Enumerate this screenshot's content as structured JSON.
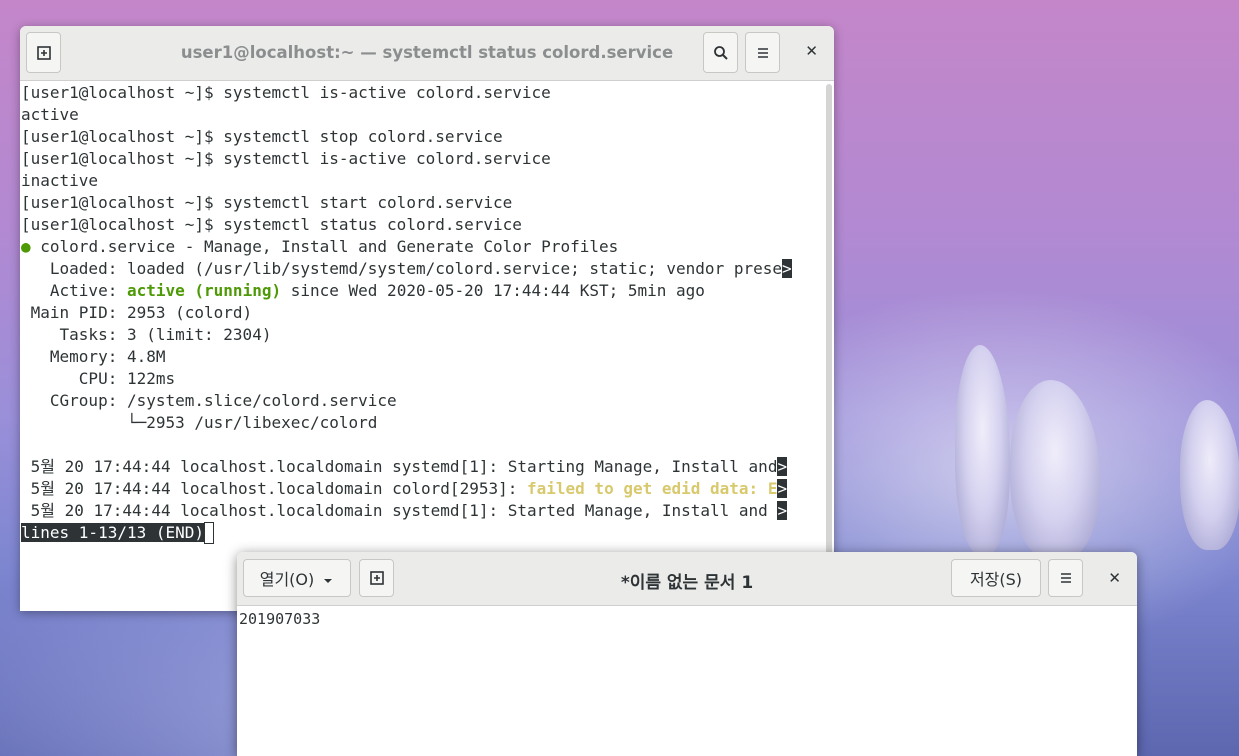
{
  "terminal": {
    "title": "user1@localhost:~ — systemctl status colord.service",
    "lines": [
      "[user1@localhost ~]$ systemctl is-active colord.service",
      "active",
      "[user1@localhost ~]$ systemctl stop colord.service",
      "[user1@localhost ~]$ systemctl is-active colord.service",
      "inactive",
      "[user1@localhost ~]$ systemctl start colord.service",
      "[user1@localhost ~]$ systemctl status colord.service"
    ],
    "status": {
      "bullet": "●",
      "service_line": " colord.service - Manage, Install and Generate Color Profiles",
      "loaded": "   Loaded: loaded (/usr/lib/systemd/system/colord.service; static; vendor prese",
      "active_label": "   Active: ",
      "active_value": "active (running)",
      "active_rest": " since Wed 2020-05-20 17:44:44 KST; 5min ago",
      "main_pid": " Main PID: 2953 (colord)",
      "tasks": "    Tasks: 3 (limit: 2304)",
      "memory": "   Memory: 4.8M",
      "cpu": "      CPU: 122ms",
      "cgroup": "   CGroup: /system.slice/colord.service",
      "cgroup_child": "           └─2953 /usr/libexec/colord"
    },
    "log": {
      "line1": " 5월 20 17:44:44 localhost.localdomain systemd[1]: Starting Manage, Install and",
      "line2_prefix": " 5월 20 17:44:44 localhost.localdomain colord[2953]: ",
      "line2_warn": "failed to get edid data: E",
      "line3": " 5월 20 17:44:44 localhost.localdomain systemd[1]: Started Manage, Install and "
    },
    "trunc_marker": ">",
    "pager_status": "lines 1-13/13 (END)"
  },
  "editor": {
    "open_label": "열기(O)",
    "title": "*이름 없는 문서 1",
    "save_label": "저장(S)",
    "content": "201907033"
  }
}
